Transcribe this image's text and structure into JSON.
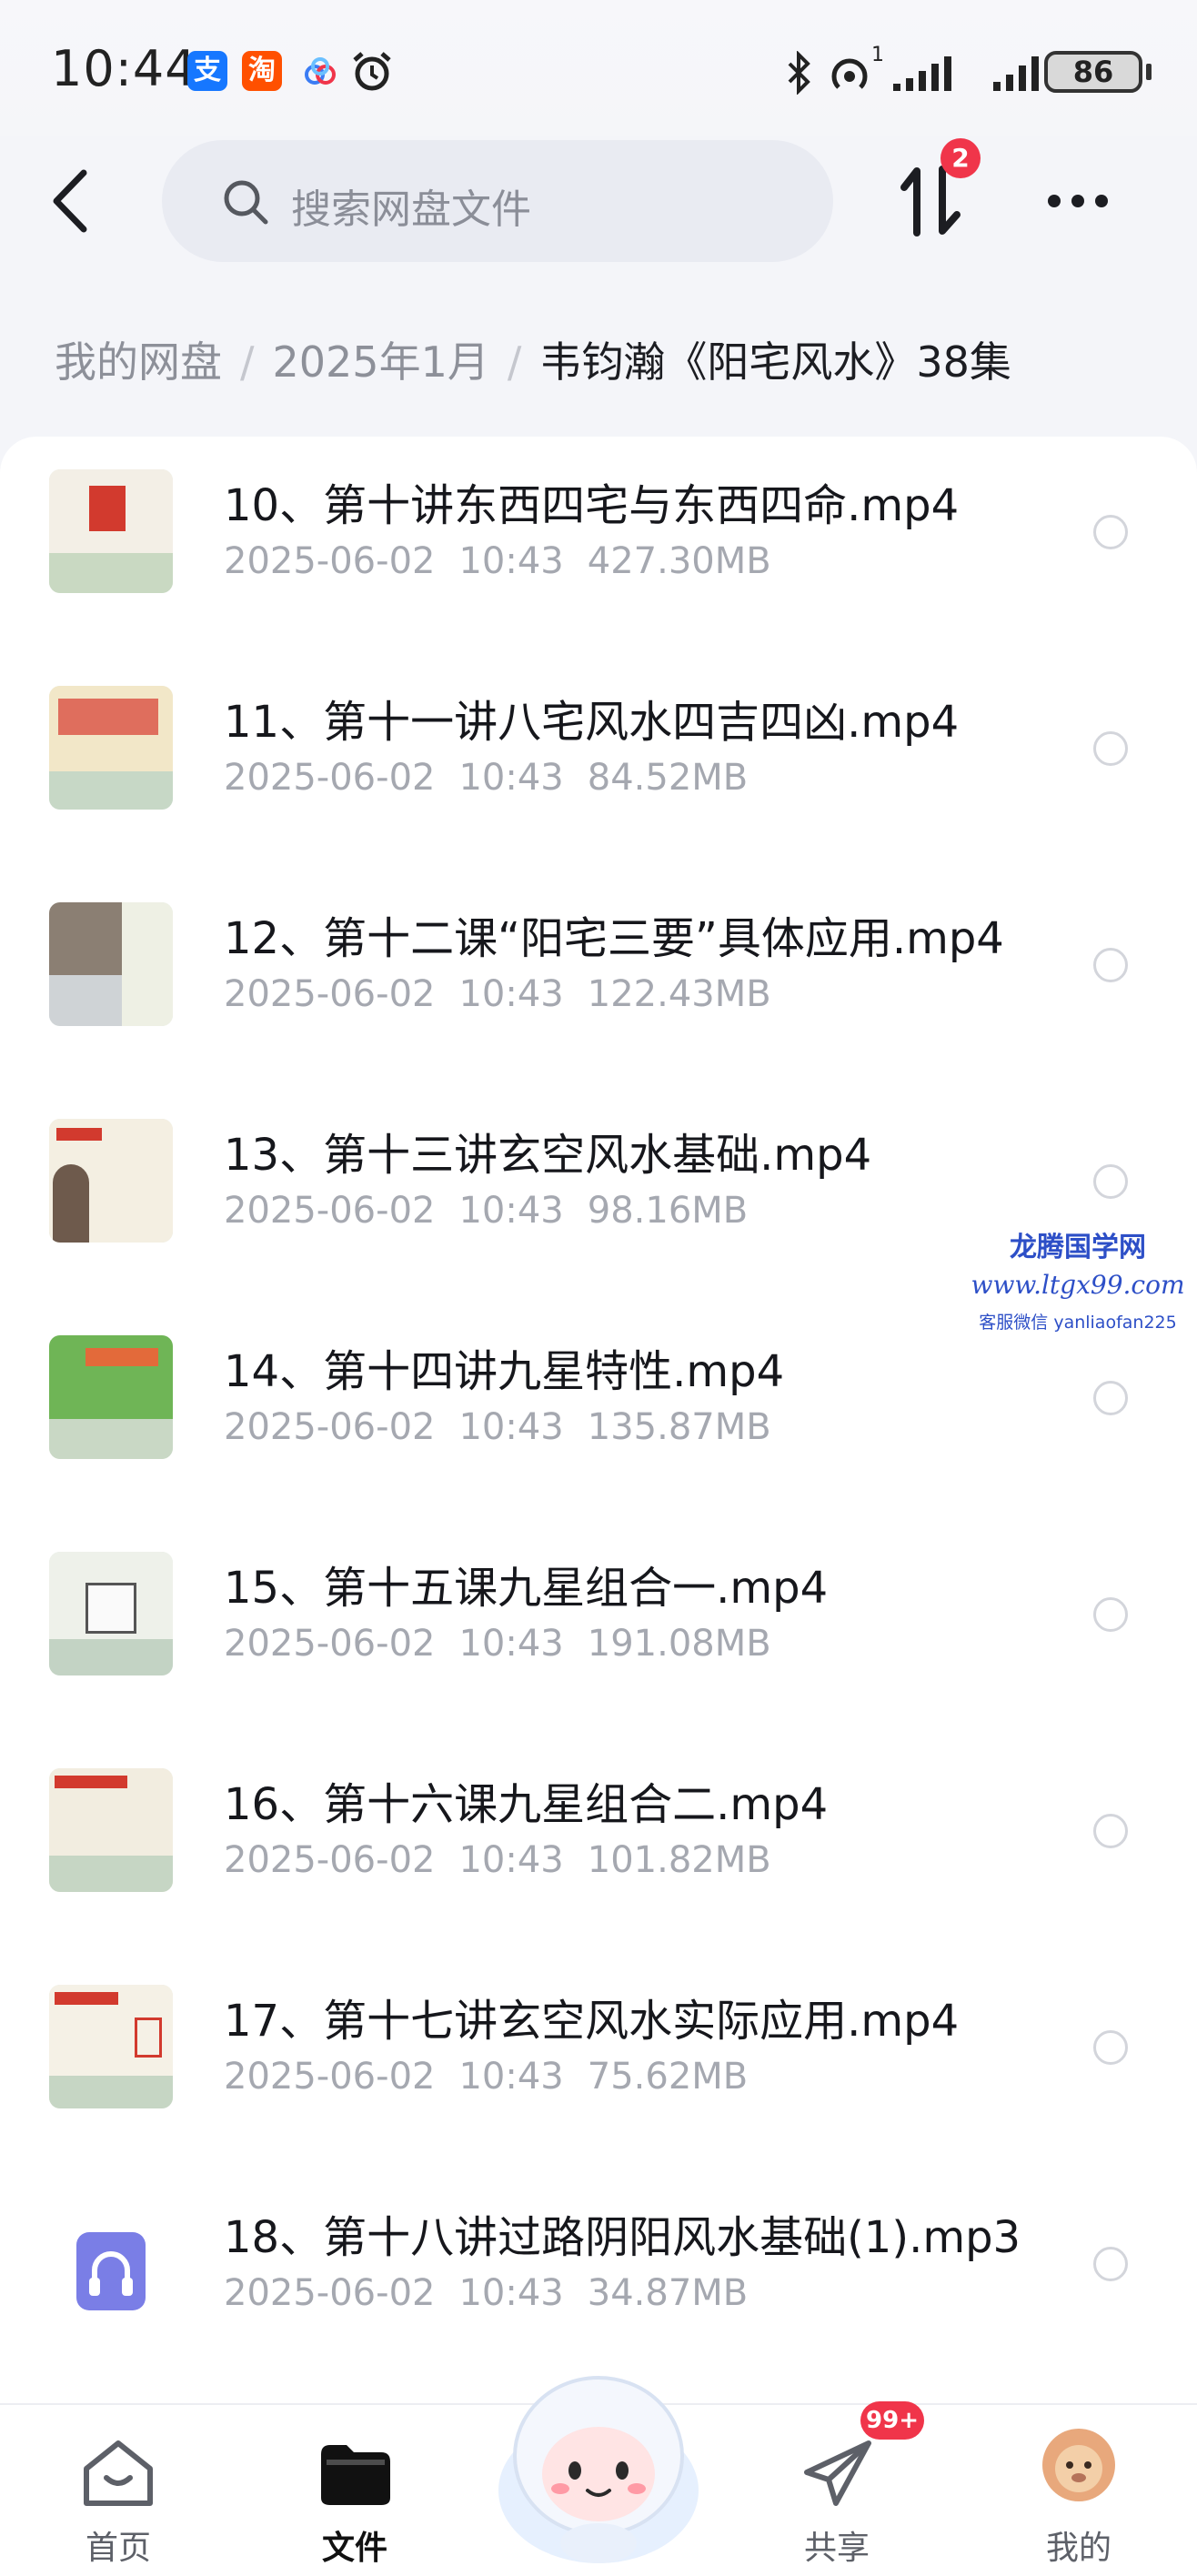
{
  "status_bar": {
    "time": "10:44",
    "app_icons": [
      "alipay-icon",
      "taobao-icon",
      "cloud-icon",
      "alarm-icon"
    ],
    "battery": "86",
    "hotspot_sup": "1"
  },
  "search": {
    "placeholder": "搜索网盘文件"
  },
  "transfer_badge": "2",
  "breadcrumb": {
    "items": [
      "我的网盘",
      "2025年1月"
    ],
    "current": "韦钧瀚《阳宅风水》38集"
  },
  "files": [
    {
      "name": "10、第十讲东西四宅与东西四命.mp4",
      "date": "2025-06-02",
      "time": "10:43",
      "size": "427.30MB",
      "thumb": "video"
    },
    {
      "name": "11、第十一讲八宅风水四吉四凶.mp4",
      "date": "2025-06-02",
      "time": "10:43",
      "size": "84.52MB",
      "thumb": "video"
    },
    {
      "name": "12、第十二课“阳宅三要”具体应用.mp4",
      "date": "2025-06-02",
      "time": "10:43",
      "size": "122.43MB",
      "thumb": "video"
    },
    {
      "name": "13、第十三讲玄空风水基础.mp4",
      "date": "2025-06-02",
      "time": "10:43",
      "size": "98.16MB",
      "thumb": "video"
    },
    {
      "name": "14、第十四讲九星特性.mp4",
      "date": "2025-06-02",
      "time": "10:43",
      "size": "135.87MB",
      "thumb": "video"
    },
    {
      "name": "15、第十五课九星组合一.mp4",
      "date": "2025-06-02",
      "time": "10:43",
      "size": "191.08MB",
      "thumb": "video"
    },
    {
      "name": "16、第十六课九星组合二.mp4",
      "date": "2025-06-02",
      "time": "10:43",
      "size": "101.82MB",
      "thumb": "video"
    },
    {
      "name": "17、第十七讲玄空风水实际应用.mp4",
      "date": "2025-06-02",
      "time": "10:43",
      "size": "75.62MB",
      "thumb": "video"
    },
    {
      "name": "18、第十八讲过路阴阳风水基础(1).mp3",
      "date": "2025-06-02",
      "time": "10:43",
      "size": "34.87MB",
      "thumb": "audio"
    }
  ],
  "watermark": {
    "title": "龙腾国学网",
    "url": "www.ltgx99.com",
    "contact": "客服微信 yanliaofan225"
  },
  "tabs": [
    {
      "label": "首页",
      "icon": "home-icon",
      "active": false
    },
    {
      "label": "文件",
      "icon": "folder-icon",
      "active": true
    },
    {
      "label": "共享",
      "icon": "share-plane-icon",
      "active": false
    },
    {
      "label": "我的",
      "icon": "avatar-icon",
      "active": false
    }
  ],
  "share_badge": "99+",
  "colors": {
    "accent_red": "#f0354a",
    "audio_icon": "#7a7ee6",
    "watermark_blue": "#2d4fc7"
  }
}
